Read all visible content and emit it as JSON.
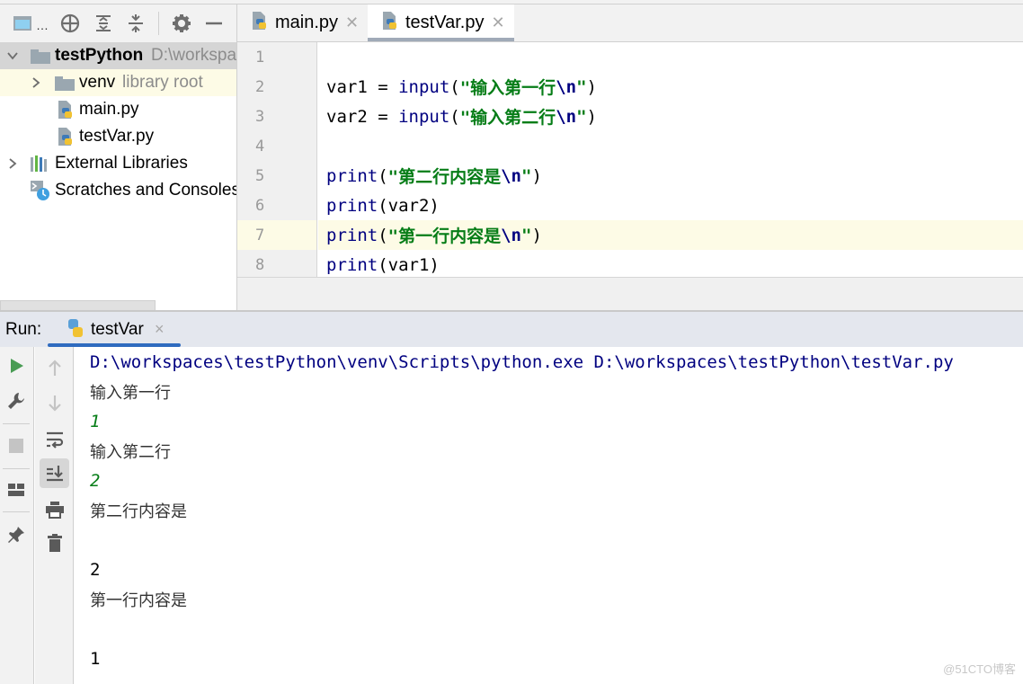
{
  "project_toolbar": {
    "icons": [
      "project-view-icon",
      "locate-icon",
      "expand-all-icon",
      "collapse-all-icon",
      "settings-icon",
      "hide-icon"
    ],
    "more": "…"
  },
  "project_tree": {
    "root": {
      "label": "testPython",
      "hint": "D:\\workspa",
      "expanded": true
    },
    "items": [
      {
        "label": "venv",
        "hint": "library root",
        "type": "folder",
        "expanded": false
      },
      {
        "label": "main.py",
        "type": "python-file"
      },
      {
        "label": "testVar.py",
        "type": "python-file"
      },
      {
        "label": "External Libraries",
        "type": "libraries",
        "expanded": false
      },
      {
        "label": "Scratches and Consoles",
        "type": "scratches"
      }
    ]
  },
  "editor": {
    "tabs": [
      {
        "label": "main.py",
        "active": false
      },
      {
        "label": "testVar.py",
        "active": true
      }
    ],
    "current_line": 7,
    "lines": [
      {
        "n": "1",
        "tokens": []
      },
      {
        "n": "2",
        "tokens": [
          [
            "plain",
            "var1 = "
          ],
          [
            "builtin",
            "input"
          ],
          [
            "plain",
            "("
          ],
          [
            "str",
            "\"输入第一行"
          ],
          [
            "esc",
            "\\n"
          ],
          [
            "str",
            "\""
          ],
          [
            "plain",
            ")"
          ]
        ]
      },
      {
        "n": "3",
        "tokens": [
          [
            "plain",
            "var2 = "
          ],
          [
            "builtin",
            "input"
          ],
          [
            "plain",
            "("
          ],
          [
            "str",
            "\"输入第二行"
          ],
          [
            "esc",
            "\\n"
          ],
          [
            "str",
            "\""
          ],
          [
            "plain",
            ")"
          ]
        ]
      },
      {
        "n": "4",
        "tokens": []
      },
      {
        "n": "5",
        "tokens": [
          [
            "builtin",
            "print"
          ],
          [
            "plain",
            "("
          ],
          [
            "str",
            "\"第二行内容是"
          ],
          [
            "esc",
            "\\n"
          ],
          [
            "str",
            "\""
          ],
          [
            "plain",
            ")"
          ]
        ]
      },
      {
        "n": "6",
        "tokens": [
          [
            "builtin",
            "print"
          ],
          [
            "plain",
            "(var2)"
          ]
        ]
      },
      {
        "n": "7",
        "tokens": [
          [
            "builtin",
            "print"
          ],
          [
            "plain",
            "("
          ],
          [
            "str",
            "\"第一行内容是"
          ],
          [
            "esc",
            "\\n"
          ],
          [
            "str",
            "\""
          ],
          [
            "plain",
            ")"
          ]
        ]
      },
      {
        "n": "8",
        "tokens": [
          [
            "builtin",
            "print"
          ],
          [
            "plain",
            "(var1)"
          ]
        ]
      }
    ]
  },
  "run": {
    "label": "Run:",
    "tab": {
      "label": "testVar",
      "close": "×"
    },
    "console": [
      {
        "kind": "cmd",
        "text": "D:\\workspaces\\testPython\\venv\\Scripts\\python.exe D:\\workspaces\\testPython\\testVar.py"
      },
      {
        "kind": "cjk",
        "text": "输入第一行"
      },
      {
        "kind": "input",
        "text": "1"
      },
      {
        "kind": "cjk",
        "text": "输入第二行"
      },
      {
        "kind": "input",
        "text": "2"
      },
      {
        "kind": "cjk",
        "text": "第二行内容是"
      },
      {
        "kind": "blank",
        "text": ""
      },
      {
        "kind": "out",
        "text": "2"
      },
      {
        "kind": "cjk",
        "text": "第一行内容是"
      },
      {
        "kind": "blank",
        "text": ""
      },
      {
        "kind": "out",
        "text": "1"
      }
    ]
  },
  "watermark": "@51CTO博客",
  "colors": {
    "run_green": "#499c54",
    "accent_tab": "#2f6bbf",
    "string_green": "#067d17",
    "keyword_navy": "#000080"
  }
}
